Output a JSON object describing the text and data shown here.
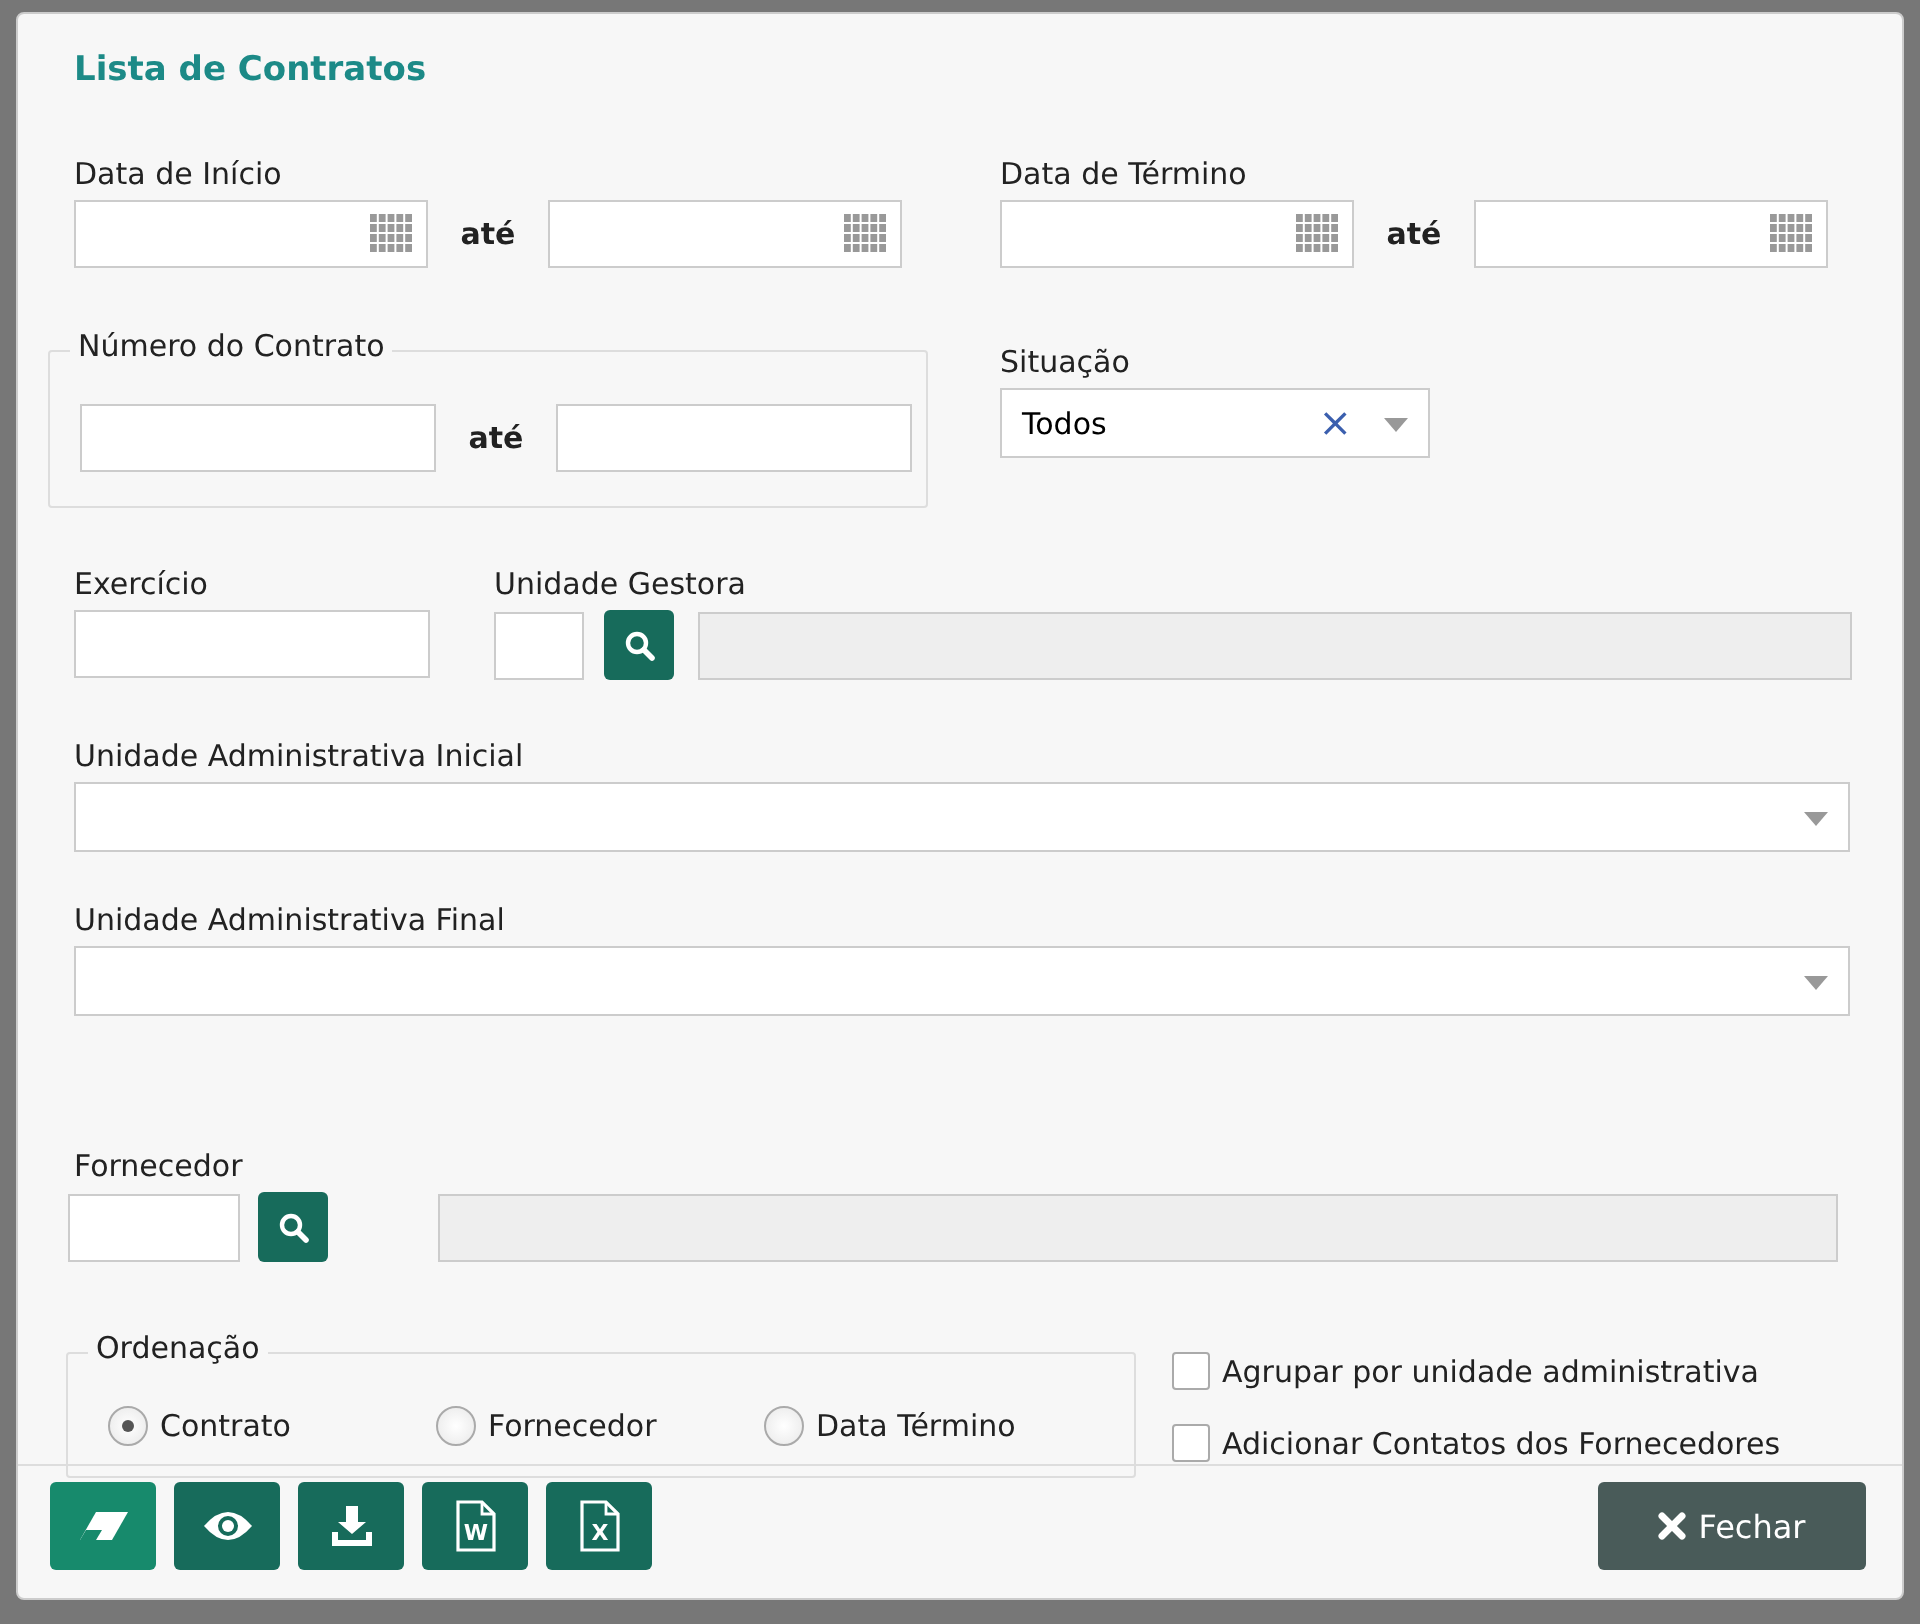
{
  "title": "Lista de Contratos",
  "data_inicio": {
    "label": "Data de Início",
    "separator": "até"
  },
  "data_termino": {
    "label": "Data de Término",
    "separator": "até"
  },
  "numero_contrato": {
    "legend": "Número do Contrato",
    "separator": "até"
  },
  "situacao": {
    "label": "Situação",
    "value": "Todos",
    "clear": "×"
  },
  "exercicio": {
    "label": "Exercício"
  },
  "unidade_gestora": {
    "label": "Unidade Gestora"
  },
  "unidade_inicial": {
    "label": "Unidade Administrativa Inicial"
  },
  "unidade_final": {
    "label": "Unidade Administrativa Final"
  },
  "fornecedor": {
    "label": "Fornecedor"
  },
  "ordenacao": {
    "legend": "Ordenação",
    "options": [
      {
        "label": "Contrato",
        "selected": true
      },
      {
        "label": "Fornecedor",
        "selected": false
      },
      {
        "label": "Data Término",
        "selected": false
      }
    ]
  },
  "checkboxes": [
    {
      "label": "Agrupar por unidade administrativa",
      "checked": false
    },
    {
      "label": "Adicionar Contatos dos Fornecedores",
      "checked": false
    }
  ],
  "toolbar": [
    {
      "kind": "eraser"
    },
    {
      "kind": "eye"
    },
    {
      "kind": "download"
    },
    {
      "kind": "doc",
      "glyph": "W"
    },
    {
      "kind": "doc",
      "glyph": "X"
    }
  ],
  "close_button": {
    "label": "Fechar"
  }
}
